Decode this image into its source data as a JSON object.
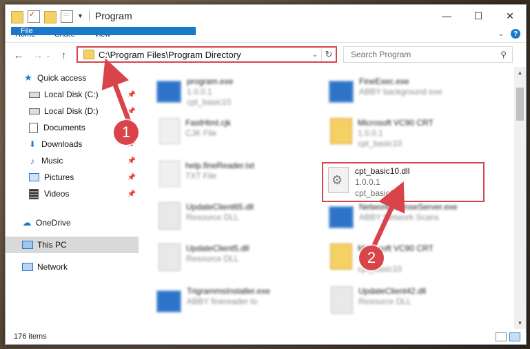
{
  "window": {
    "title": "Program",
    "controls": {
      "minimize": "—",
      "maximize": "☐",
      "close": "✕"
    }
  },
  "ribbon": {
    "tabs": [
      "File",
      "Home",
      "Share",
      "View"
    ]
  },
  "address": {
    "path": "C:\\Program Files\\Program Directory",
    "search_placeholder": "Search Program"
  },
  "nav_pane": {
    "items": [
      {
        "label": "Quick access",
        "icon": "star-icon"
      },
      {
        "label": "Local Disk (C:)",
        "icon": "drive-icon",
        "pinned": true
      },
      {
        "label": "Local Disk (D:)",
        "icon": "drive-icon",
        "pinned": true
      },
      {
        "label": "Documents",
        "icon": "documents-icon",
        "pinned": true
      },
      {
        "label": "Downloads",
        "icon": "download-icon",
        "pinned": true
      },
      {
        "label": "Music",
        "icon": "music-icon",
        "pinned": true
      },
      {
        "label": "Pictures",
        "icon": "pictures-icon",
        "pinned": true
      },
      {
        "label": "Videos",
        "icon": "videos-icon",
        "pinned": true
      },
      {
        "label": "OneDrive",
        "icon": "cloud-icon"
      },
      {
        "label": "This PC",
        "icon": "pc-icon",
        "selected": true
      },
      {
        "label": "Network",
        "icon": "network-icon"
      }
    ]
  },
  "files": [
    {
      "name": "program.exe",
      "line2": "1.0.0.1",
      "line3": "cpt_basic10",
      "icon": "exe"
    },
    {
      "name": "FineExec.exe",
      "line2": "ABBY background exe",
      "line3": "",
      "icon": "exe"
    },
    {
      "name": "FastHtml.cjk",
      "line2": "CJK File",
      "line3": "",
      "icon": "doc"
    },
    {
      "name": "Microsoft VC90 CRT",
      "line2": "1.0.0.1",
      "line3": "cpt_basic10",
      "icon": "folder"
    },
    {
      "name": "help.fineReader.txt",
      "line2": "TXT File",
      "line3": "",
      "icon": "doc"
    },
    {
      "name": "UpdateClient65.dll",
      "line2": "Resource DLL",
      "line3": "",
      "icon": "dll"
    },
    {
      "name": "NetworkLicenseServer.exe",
      "line2": "ABBY Network Scans",
      "line3": "",
      "icon": "exe"
    },
    {
      "name": "UpdateClient5.dll",
      "line2": "Resource DLL",
      "line3": "",
      "icon": "dll"
    },
    {
      "name": "Microsoft VC90 CRT",
      "line2": "1.0.0.1",
      "line3": "cpt_basic10",
      "icon": "folder"
    },
    {
      "name": "TrigrammsInstaller.exe",
      "line2": "ABBY finereader to",
      "line3": "",
      "icon": "exe"
    },
    {
      "name": "UpdateClient42.dll",
      "line2": "Resource DLL",
      "line3": "",
      "icon": "dll"
    }
  ],
  "highlighted_file": {
    "name": "cpt_basic10.dll",
    "version": "1.0.0.1",
    "company": "cpt_basic10"
  },
  "status": {
    "count": "176 items"
  },
  "annotations": {
    "step1": "1",
    "step2": "2",
    "color": "#d9434a"
  }
}
